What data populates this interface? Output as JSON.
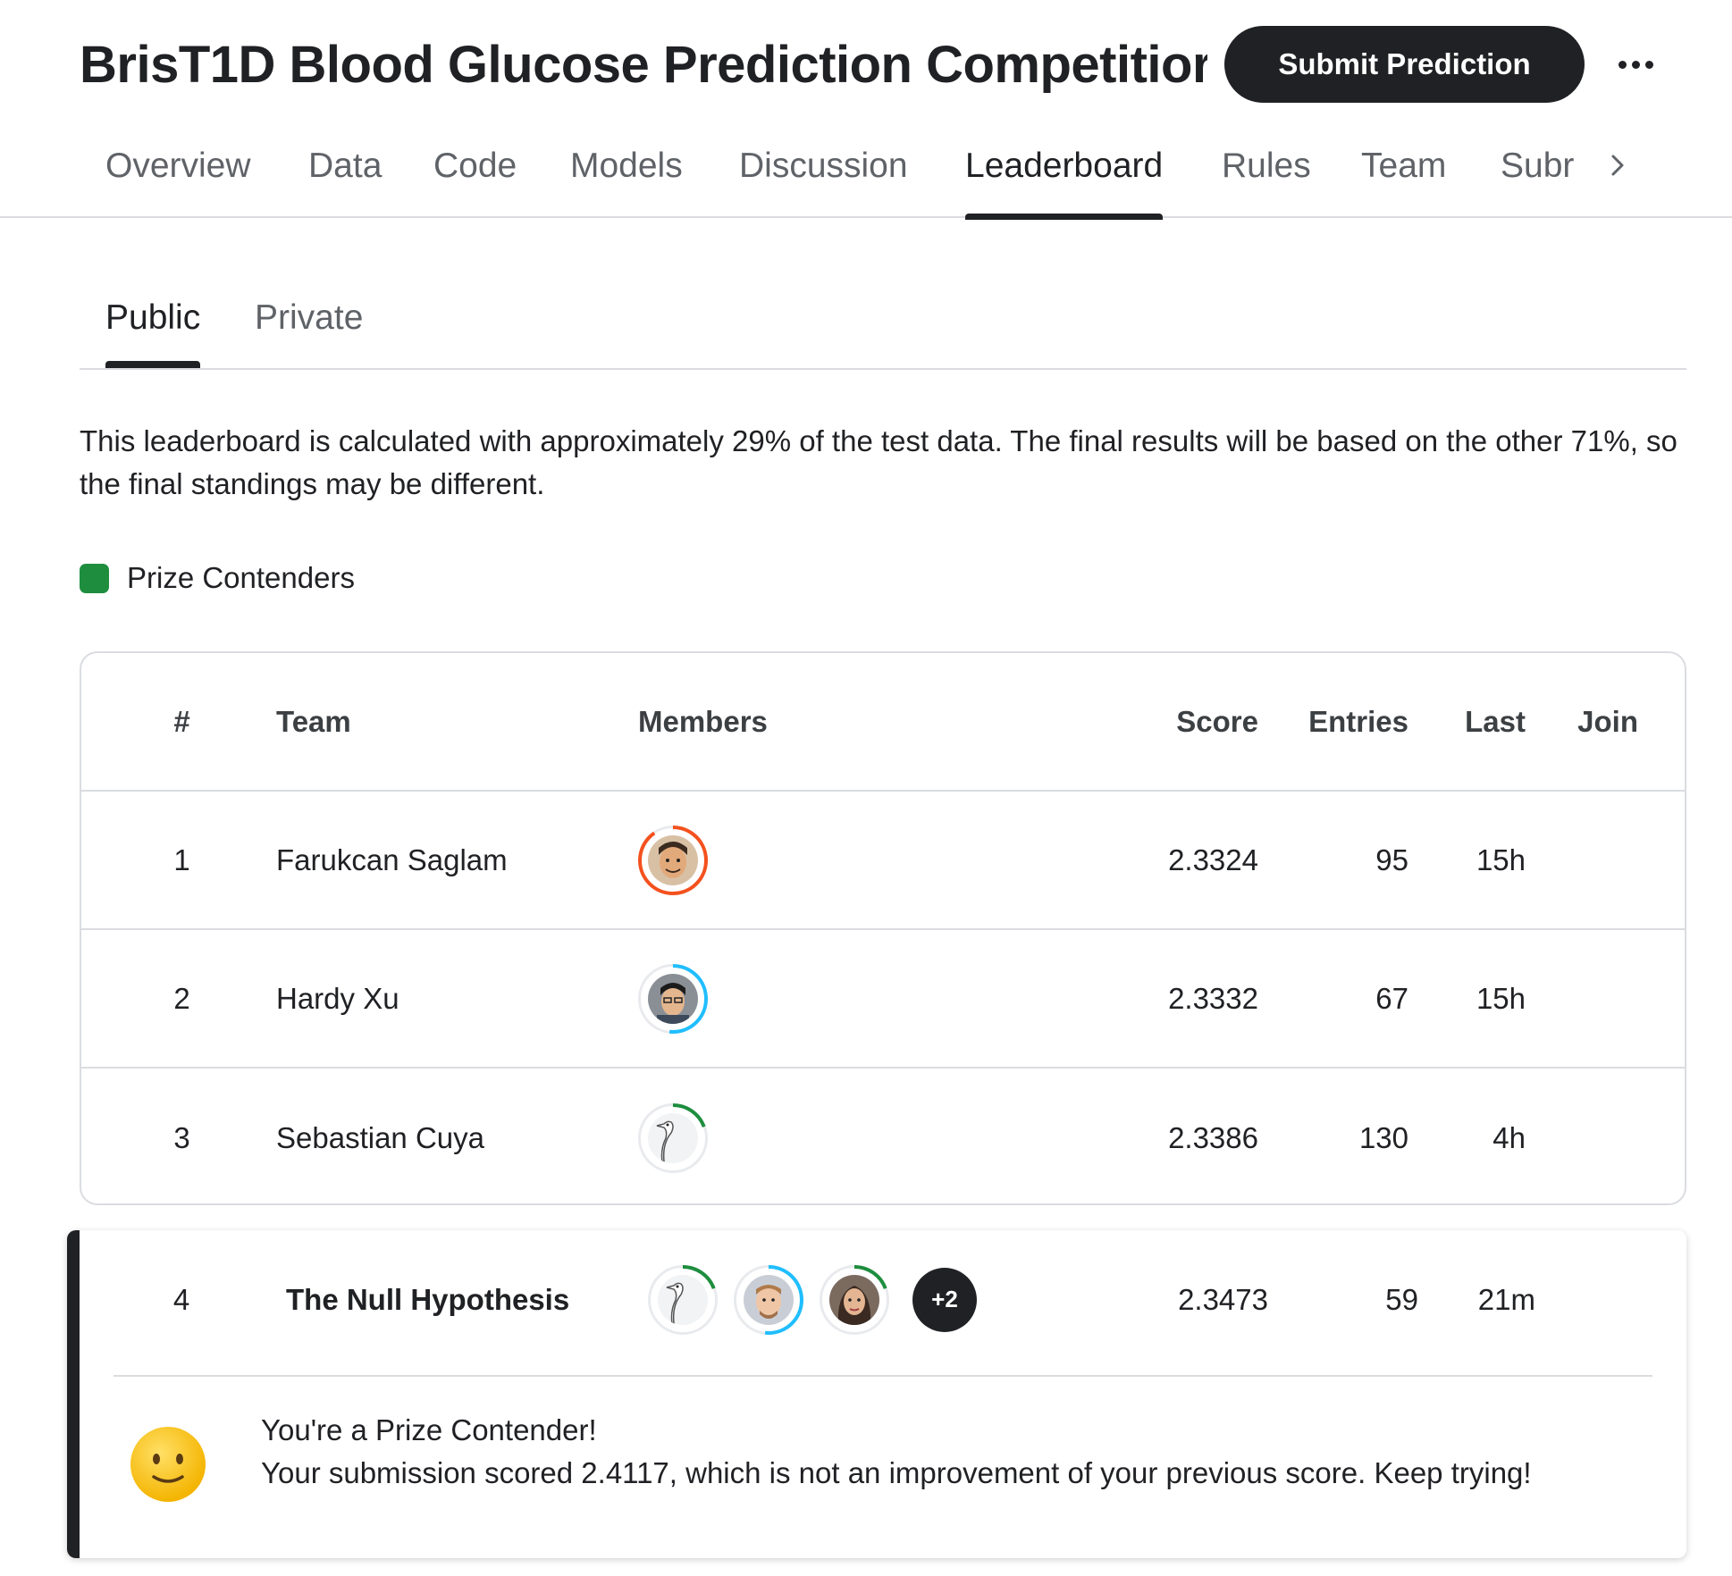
{
  "header": {
    "title": "BrisT1D Blood Glucose Prediction Competitior",
    "submit_label": "Submit Prediction",
    "more_icon": "more-horizontal-icon"
  },
  "tabs": [
    {
      "label": "Overview"
    },
    {
      "label": "Data"
    },
    {
      "label": "Code"
    },
    {
      "label": "Models"
    },
    {
      "label": "Discussion"
    },
    {
      "label": "Leaderboard",
      "active": true
    },
    {
      "label": "Rules"
    },
    {
      "label": "Team"
    },
    {
      "label": "Subr"
    }
  ],
  "subtabs": [
    {
      "label": "Public",
      "active": true
    },
    {
      "label": "Private"
    }
  ],
  "info_text": "This leaderboard is calculated with approximately 29% of the test data. The final results will be based on the other 71%, so the final standings may be different.",
  "legend": {
    "label": "Prize Contenders",
    "color": "#1e8e3e"
  },
  "table": {
    "columns": {
      "rank": "#",
      "team": "Team",
      "members": "Members",
      "score": "Score",
      "entries": "Entries",
      "last": "Last",
      "join": "Join"
    },
    "rows": [
      {
        "rank": "1",
        "team": "Farukcan Saglam",
        "score": "2.3324",
        "entries": "95",
        "last": "15h"
      },
      {
        "rank": "2",
        "team": "Hardy Xu",
        "score": "2.3332",
        "entries": "67",
        "last": "15h"
      },
      {
        "rank": "3",
        "team": "Sebastian Cuya",
        "score": "2.3386",
        "entries": "130",
        "last": "4h"
      }
    ]
  },
  "my_team": {
    "rank": "4",
    "team": "The Null Hypothesis",
    "extra_members": "+2",
    "score": "2.3473",
    "entries": "59",
    "last": "21m",
    "message_title": "You're a Prize Contender!",
    "message_body": "Your submission scored 2.4117, which is not an improvement of your previous score. Keep trying!"
  },
  "ring_colors": {
    "orange": "#f4511e",
    "blue": "#20beff",
    "green": "#1e8e3e"
  }
}
